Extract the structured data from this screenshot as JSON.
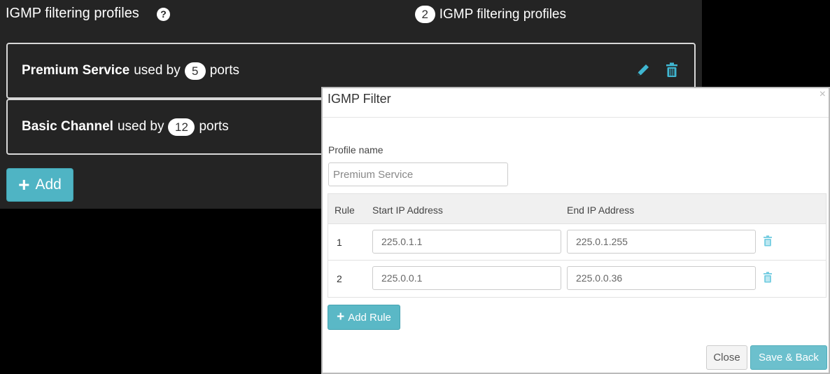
{
  "header": {
    "title": "IGMP filtering profiles",
    "help_icon": "question-circle-icon",
    "profile_count": "2",
    "profile_count_label": "IGMP filtering profiles"
  },
  "profiles": [
    {
      "name": "Premium Service",
      "used_by_text": "used by",
      "ports_count": "5",
      "ports_text": "ports"
    },
    {
      "name": "Basic Channel",
      "used_by_text": "used by",
      "ports_count": "12",
      "ports_text": "ports"
    }
  ],
  "add_button": {
    "label": "Add",
    "icon": "plus-icon"
  },
  "modal": {
    "title": "IGMP Filter",
    "close_glyph": "×",
    "profile_label": "Profile name",
    "profile_value": "Premium Service",
    "columns": {
      "rule": "Rule",
      "start": "Start IP Address",
      "end": "End IP Address"
    },
    "rules": [
      {
        "num": "1",
        "start": "225.0.1.1",
        "end": "225.0.1.255"
      },
      {
        "num": "2",
        "start": "225.0.0.1",
        "end": "225.0.0.36"
      }
    ],
    "add_rule_label": "Add Rule",
    "close_label": "Close",
    "save_label": "Save & Back"
  },
  "colors": {
    "accent": "#4fb4c4",
    "background_dark": "#242424",
    "icon_teal": "#3fb6d1"
  }
}
